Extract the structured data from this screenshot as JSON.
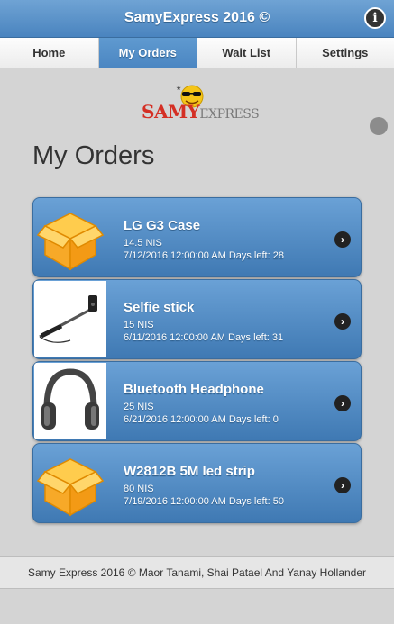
{
  "header": {
    "title": "SamyExpress 2016 ©",
    "info_icon": "i"
  },
  "nav": {
    "tabs": [
      {
        "label": "Home",
        "active": false
      },
      {
        "label": "My Orders",
        "active": true
      },
      {
        "label": "Wait List",
        "active": false
      },
      {
        "label": "Settings",
        "active": false
      }
    ]
  },
  "logo": {
    "brand_main": "SAMY",
    "brand_rest": "EXPRESS"
  },
  "page": {
    "title": "My Orders"
  },
  "orders": [
    {
      "name": "LG G3 Case",
      "price": "14.5 NIS",
      "dates": "7/12/2016 12:00:00 AM Days left: 28",
      "thumbnail": "package-icon"
    },
    {
      "name": "Selfie stick",
      "price": "15 NIS",
      "dates": "6/11/2016 12:00:00 AM Days left: 31",
      "thumbnail": "selfie-stick-photo"
    },
    {
      "name": "Bluetooth Headphone",
      "price": "25 NIS",
      "dates": "6/21/2016 12:00:00 AM Days left: 0",
      "thumbnail": "headphone-photo"
    },
    {
      "name": "W2812B 5M led strip",
      "price": "80 NIS",
      "dates": "7/19/2016 12:00:00 AM Days left: 50",
      "thumbnail": "package-icon"
    }
  ],
  "footer": {
    "text": "Samy Express 2016  ©   Maor Tanami, Shai Patael And Yanay Hollander"
  },
  "colors": {
    "accent": "#4a84bf",
    "background": "#d4d4d4",
    "brand_red": "#d42f24"
  }
}
